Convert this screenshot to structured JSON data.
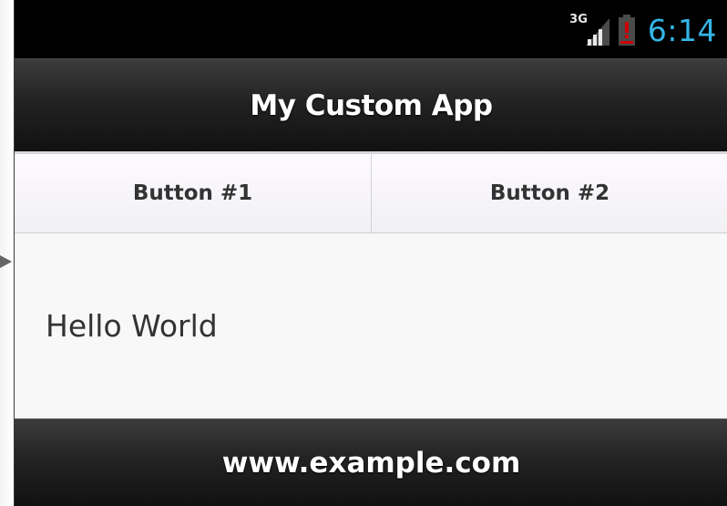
{
  "status_bar": {
    "network_type": "3G",
    "signal_icon": "cell-signal-icon",
    "battery_icon": "battery-low-alert-icon",
    "time": "6:14",
    "time_color": "#33b5e5",
    "battery_alert_color": "#cc0000"
  },
  "header": {
    "title": "My Custom App"
  },
  "navbar": {
    "buttons": [
      {
        "label": "Button #1"
      },
      {
        "label": "Button #2"
      }
    ]
  },
  "content": {
    "text": "Hello World"
  },
  "footer": {
    "text": "www.example.com"
  },
  "backdrop": {
    "pointer_icon": "pointer-arrow-icon"
  }
}
